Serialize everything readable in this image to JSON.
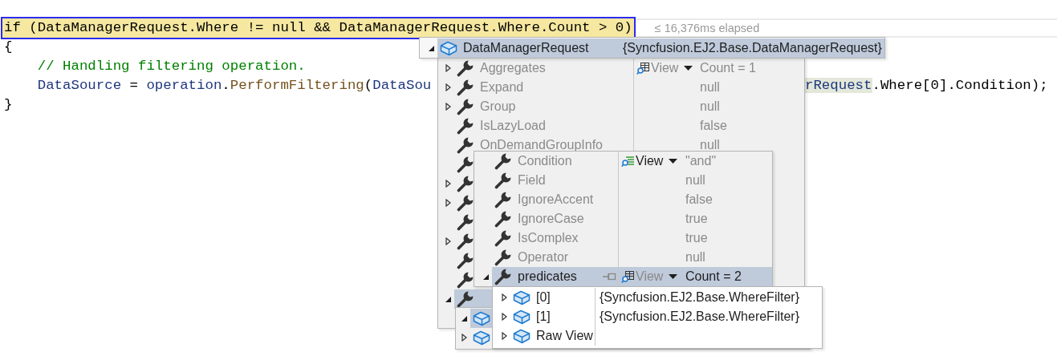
{
  "code_lines": [
    {
      "current": true,
      "segments": [
        {
          "kind": "plain",
          "text": "if (DataManagerRequest.Where != null && DataManagerRequest.Where.Count > 0)"
        }
      ]
    },
    {
      "current": false,
      "segments": [
        {
          "kind": "plain",
          "text": "{"
        }
      ]
    },
    {
      "current": false,
      "segments": [
        {
          "kind": "comment",
          "text": "    // Handling filtering operation."
        }
      ]
    },
    {
      "current": false,
      "segments": [
        {
          "kind": "local",
          "text": "    DataSource"
        },
        {
          "kind": "plain",
          "text": " = "
        },
        {
          "kind": "local",
          "text": "operation"
        },
        {
          "kind": "plain",
          "text": "."
        },
        {
          "kind": "method",
          "text": "PerformFiltering"
        },
        {
          "kind": "plain",
          "text": "("
        },
        {
          "kind": "local",
          "text": "DataSou"
        }
      ],
      "tail": [
        {
          "kind": "reference",
          "text": "rRequest"
        },
        {
          "kind": "plain",
          "text": ".Where[0].Condition);"
        }
      ]
    },
    {
      "current": false,
      "segments": [
        {
          "kind": "plain",
          "text": "}"
        }
      ]
    }
  ],
  "elapsed": "≤ 16,376ms elapsed",
  "datatip": {
    "expanded": true,
    "kind": "object",
    "name": "DataManagerRequest",
    "value": "{Syncfusion.EJ2.Base.DataManagerRequest}",
    "selected": true
  },
  "members_popup": {
    "stale": true,
    "rows": [
      {
        "expanded": false,
        "kind": "property",
        "name": "Aggregates",
        "visualizer": {
          "kind": "table",
          "label": "View",
          "disabled": true
        },
        "value": "Count = 1",
        "selected": false
      },
      {
        "expanded": false,
        "kind": "property",
        "name": "Expand",
        "value": "null",
        "selected": false
      },
      {
        "expanded": false,
        "kind": "property",
        "name": "Group",
        "value": "null",
        "selected": false
      },
      {
        "kind": "property",
        "name": "IsLazyLoad",
        "value": "false",
        "selected": false
      },
      {
        "kind": "property",
        "name": "OnDemandGroupInfo",
        "value": "null",
        "selected": false
      },
      {
        "kind": "property",
        "selected": false
      },
      {
        "expanded": false,
        "kind": "property",
        "selected": false
      },
      {
        "expanded": false,
        "kind": "property",
        "selected": false
      },
      {
        "kind": "property",
        "selected": false
      },
      {
        "expanded": false,
        "kind": "property",
        "selected": false
      },
      {
        "kind": "property",
        "selected": false
      },
      {
        "kind": "property",
        "selected": false
      },
      {
        "expanded": true,
        "kind": "property",
        "selected": true
      }
    ]
  },
  "where_popup": {
    "rows": [
      {
        "expanded": true,
        "kind": "object",
        "selected": true
      },
      {
        "expanded": false,
        "kind": "object",
        "selected": false
      }
    ]
  },
  "item_popup": {
    "stale": true,
    "rows": [
      {
        "kind": "property",
        "name": "Condition",
        "visualizer": {
          "kind": "text",
          "label": "View",
          "disabled": false
        },
        "value": "\"and\"",
        "selected": false
      },
      {
        "kind": "property",
        "name": "Field",
        "value": "null",
        "selected": false
      },
      {
        "kind": "property",
        "name": "IgnoreAccent",
        "value": "false",
        "selected": false
      },
      {
        "kind": "property",
        "name": "IgnoreCase",
        "value": "true",
        "selected": false
      },
      {
        "kind": "property",
        "name": "IsComplex",
        "value": "true",
        "selected": false
      },
      {
        "kind": "property",
        "name": "Operator",
        "value": "null",
        "selected": false
      },
      {
        "expanded": true,
        "kind": "property",
        "name": "predicates",
        "pin": true,
        "visualizer": {
          "kind": "table",
          "label": "View",
          "disabled": true
        },
        "value": "Count = 2",
        "selected": true
      }
    ]
  },
  "predicates_popup": {
    "rows": [
      {
        "expanded": false,
        "kind": "object",
        "name": "[0]",
        "value": "{Syncfusion.EJ2.Base.WhereFilter}",
        "selected": false
      },
      {
        "expanded": false,
        "kind": "object",
        "name": "[1]",
        "value": "{Syncfusion.EJ2.Base.WhereFilter}",
        "selected": false
      },
      {
        "expanded": false,
        "kind": "object",
        "name": "Raw View",
        "selected": false
      }
    ]
  }
}
